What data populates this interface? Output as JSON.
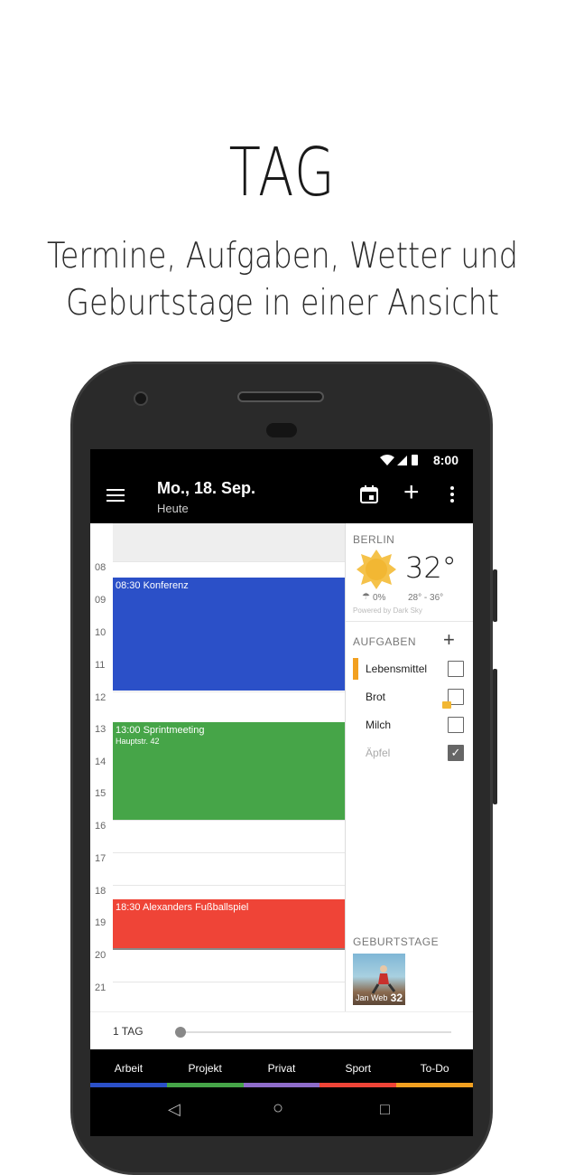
{
  "promo": {
    "title": "TAG",
    "subtitle_line1": "Termine, Aufgaben, Wetter und",
    "subtitle_line2": "Geburtstage in einer Ansicht"
  },
  "statusbar": {
    "time": "8:00"
  },
  "appbar": {
    "title": "Mo., 18. Sep.",
    "subtitle": "Heute",
    "icons": [
      "menu-icon",
      "calendar-today-icon",
      "add-icon",
      "more-vert-icon"
    ]
  },
  "calendar": {
    "hours": [
      "08",
      "09",
      "10",
      "11",
      "12",
      "13",
      "14",
      "15",
      "16",
      "17",
      "18",
      "19",
      "20",
      "21"
    ],
    "events": [
      {
        "time": "08:30",
        "title": "Konferenz",
        "location": "",
        "color": "#2b50c8"
      },
      {
        "time": "13:00",
        "title": "Sprintmeeting",
        "location": "Hauptstr. 42",
        "color": "#46a548"
      },
      {
        "time": "18:30",
        "title": "Alexanders Fußballspiel",
        "location": "",
        "color": "#ef4437"
      }
    ]
  },
  "weather": {
    "city": "BERLIN",
    "temperature": "32°",
    "precip": "0%",
    "range": "28° - 36°",
    "credit": "Powered by Dark Sky",
    "icon": "sunny-icon"
  },
  "tasks": {
    "header": "AUFGABEN",
    "items": [
      {
        "label": "Lebensmittel",
        "done": false
      },
      {
        "label": "Brot",
        "done": false
      },
      {
        "label": "Milch",
        "done": false
      },
      {
        "label": "Äpfel",
        "done": true
      }
    ]
  },
  "birthdays": {
    "header": "GEBURTSTAGE",
    "items": [
      {
        "name": "Jan Web",
        "age": "32"
      }
    ]
  },
  "zoom": {
    "label": "1 TAG",
    "level": 0.0
  },
  "tabs": [
    {
      "label": "Arbeit",
      "color": "#2b50c8"
    },
    {
      "label": "Projekt",
      "color": "#46a548"
    },
    {
      "label": "Privat",
      "color": "#8e6cc9"
    },
    {
      "label": "Sport",
      "color": "#ef4437"
    },
    {
      "label": "To-Do",
      "color": "#f2a020"
    }
  ],
  "navbar": {
    "back": "◁",
    "home": "○",
    "recents": "□"
  }
}
